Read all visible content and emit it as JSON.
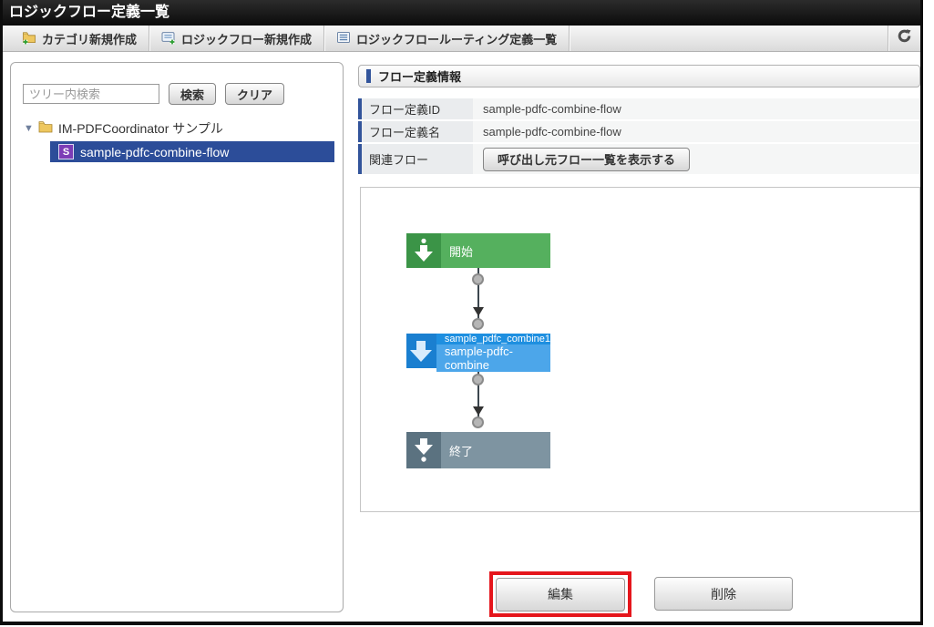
{
  "window": {
    "title": "ロジックフロー定義一覧"
  },
  "toolbar": {
    "buttons": [
      {
        "label": "カテゴリ新規作成",
        "icon": "folder-plus-icon"
      },
      {
        "label": "ロジックフロー新規作成",
        "icon": "flow-new-icon"
      },
      {
        "label": "ロジックフロールーティング定義一覧",
        "icon": "list-icon"
      }
    ],
    "refresh_icon": "refresh-icon"
  },
  "sidebar": {
    "search": {
      "placeholder": "ツリー内検索",
      "search_label": "検索",
      "clear_label": "クリア"
    },
    "tree": {
      "folder_label": "IM-PDFCoordinator サンプル",
      "item_badge": "S",
      "item_label": "sample-pdfc-combine-flow"
    }
  },
  "detail": {
    "section_title": "フロー定義情報",
    "rows": [
      {
        "label": "フロー定義ID",
        "value": "sample-pdfc-combine-flow"
      },
      {
        "label": "フロー定義名",
        "value": "sample-pdfc-combine-flow"
      },
      {
        "label": "関連フロー",
        "button_label": "呼び出し元フロー一覧を表示する"
      }
    ]
  },
  "flow": {
    "nodes": {
      "start": {
        "label": "開始",
        "color": "#55b05e",
        "icon": "start-arrow-icon"
      },
      "task": {
        "label_top": "sample_pdfc_combine1",
        "label_bottom": "sample-pdfc-combine",
        "color": "#4ca6ea",
        "icon": "task-arrow-icon"
      },
      "end": {
        "label": "終了",
        "color": "#7e94a1",
        "icon": "end-arrow-icon"
      }
    }
  },
  "actions": {
    "edit_label": "編集",
    "delete_label": "削除"
  },
  "colors": {
    "titlebar": "#0c0c0c",
    "accent_blue": "#32549b",
    "selected_row": "#2c4d99",
    "badge_purple": "#7c3cb6",
    "annotation_red": "#e5161c",
    "node_start": "#55b05e",
    "node_task": "#4ca6ea",
    "node_end": "#7e94a1"
  }
}
